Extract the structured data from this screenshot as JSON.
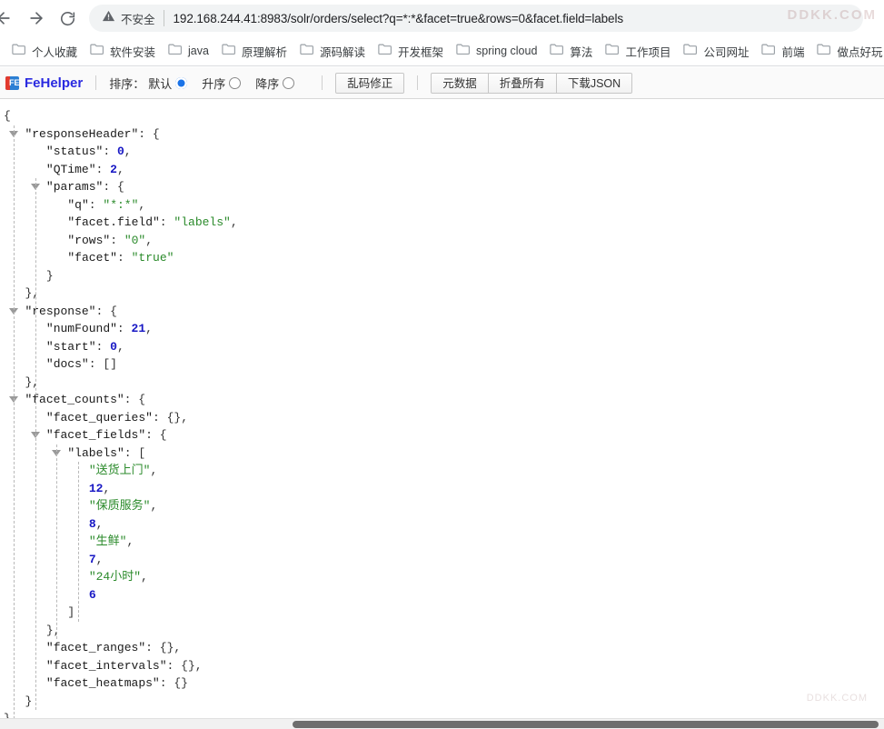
{
  "browser": {
    "back_icon": "back-arrow-icon",
    "forward_icon": "forward-arrow-icon",
    "reload_icon": "reload-icon",
    "security_label": "不安全",
    "security_icon": "warning-triangle-icon",
    "url": "192.168.244.41:8983/solr/orders/select?q=*:*&facet=true&rows=0&facet.field=labels",
    "watermark_top": "DDKK.COM",
    "watermark_bottom": "DDKK.COM"
  },
  "bookmarks": {
    "items": [
      {
        "label": "个人收藏",
        "icon": "folder-icon"
      },
      {
        "label": "软件安装",
        "icon": "folder-icon"
      },
      {
        "label": "java",
        "icon": "folder-icon"
      },
      {
        "label": "原理解析",
        "icon": "folder-icon"
      },
      {
        "label": "源码解读",
        "icon": "folder-icon"
      },
      {
        "label": "开发框架",
        "icon": "folder-icon"
      },
      {
        "label": "spring cloud",
        "icon": "folder-icon"
      },
      {
        "label": "算法",
        "icon": "folder-icon"
      },
      {
        "label": "工作项目",
        "icon": "folder-icon"
      },
      {
        "label": "公司网址",
        "icon": "folder-icon"
      },
      {
        "label": "前端",
        "icon": "folder-icon"
      },
      {
        "label": "做点好玩",
        "icon": "folder-icon"
      }
    ]
  },
  "toolbar": {
    "brand": "FeHelper",
    "logo_text": "FE",
    "sort_label": "排序：",
    "sort_options": [
      {
        "label": "默认",
        "selected": true
      },
      {
        "label": "升序",
        "selected": false
      },
      {
        "label": "降序",
        "selected": false
      }
    ],
    "fix_encoding_button": "乱码修正",
    "metadata_button": "元数据",
    "collapse_all_button": "折叠所有",
    "download_json_button": "下载JSON"
  },
  "json_document": {
    "raw": {
      "responseHeader": {
        "status": 0,
        "QTime": 2,
        "params": {
          "q": "*:*",
          "facet.field": "labels",
          "rows": "0",
          "facet": "true"
        }
      },
      "response": {
        "numFound": 21,
        "start": 0,
        "docs": []
      },
      "facet_counts": {
        "facet_queries": {},
        "facet_fields": {
          "labels": [
            "送货上门",
            12,
            "保质服务",
            8,
            "生鲜",
            7,
            "24小时",
            6
          ]
        },
        "facet_ranges": {},
        "facet_intervals": {},
        "facet_heatmaps": {}
      }
    },
    "lines": [
      {
        "indent": 0,
        "text": "{",
        "tri": false
      },
      {
        "indent": 1,
        "text": "\"responseHeader\": {",
        "tri": true
      },
      {
        "indent": 2,
        "text": "\"status\": 0,",
        "tri": false
      },
      {
        "indent": 2,
        "text": "\"QTime\": 2,",
        "tri": false
      },
      {
        "indent": 2,
        "text": "\"params\": {",
        "tri": true
      },
      {
        "indent": 3,
        "text": "\"q\": \"*:*\",",
        "tri": false
      },
      {
        "indent": 3,
        "text": "\"facet.field\": \"labels\",",
        "tri": false
      },
      {
        "indent": 3,
        "text": "\"rows\": \"0\",",
        "tri": false
      },
      {
        "indent": 3,
        "text": "\"facet\": \"true\"",
        "tri": false
      },
      {
        "indent": 2,
        "text": "}",
        "tri": false
      },
      {
        "indent": 1,
        "text": "},",
        "tri": false
      },
      {
        "indent": 1,
        "text": "\"response\": {",
        "tri": true
      },
      {
        "indent": 2,
        "text": "\"numFound\": 21,",
        "tri": false
      },
      {
        "indent": 2,
        "text": "\"start\": 0,",
        "tri": false
      },
      {
        "indent": 2,
        "text": "\"docs\": []",
        "tri": false
      },
      {
        "indent": 1,
        "text": "},",
        "tri": false
      },
      {
        "indent": 1,
        "text": "\"facet_counts\": {",
        "tri": true
      },
      {
        "indent": 2,
        "text": "\"facet_queries\": {},",
        "tri": false
      },
      {
        "indent": 2,
        "text": "\"facet_fields\": {",
        "tri": true
      },
      {
        "indent": 3,
        "text": "\"labels\": [",
        "tri": true
      },
      {
        "indent": 4,
        "text": "\"送货上门\",",
        "tri": false
      },
      {
        "indent": 4,
        "text": "12,",
        "tri": false
      },
      {
        "indent": 4,
        "text": "\"保质服务\",",
        "tri": false
      },
      {
        "indent": 4,
        "text": "8,",
        "tri": false
      },
      {
        "indent": 4,
        "text": "\"生鲜\",",
        "tri": false
      },
      {
        "indent": 4,
        "text": "7,",
        "tri": false
      },
      {
        "indent": 4,
        "text": "\"24小时\",",
        "tri": false
      },
      {
        "indent": 4,
        "text": "6",
        "tri": false
      },
      {
        "indent": 3,
        "text": "]",
        "tri": false
      },
      {
        "indent": 2,
        "text": "},",
        "tri": false
      },
      {
        "indent": 2,
        "text": "\"facet_ranges\": {},",
        "tri": false
      },
      {
        "indent": 2,
        "text": "\"facet_intervals\": {},",
        "tri": false
      },
      {
        "indent": 2,
        "text": "\"facet_heatmaps\": {}",
        "tri": false
      },
      {
        "indent": 1,
        "text": "}",
        "tri": false
      },
      {
        "indent": 0,
        "text": "}",
        "tri": false
      }
    ]
  }
}
